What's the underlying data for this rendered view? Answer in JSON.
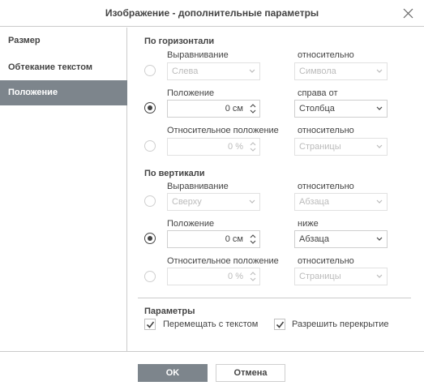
{
  "dialog": {
    "title": "Изображение - дополнительные параметры"
  },
  "sidebar": {
    "items": [
      {
        "label": "Размер"
      },
      {
        "label": "Обтекание текстом"
      },
      {
        "label": "Положение"
      }
    ]
  },
  "horizontal": {
    "title": "По горизонтали",
    "align_label": "Выравнивание",
    "align_value": "Слева",
    "align_relative_label": "относительно",
    "align_relative_value": "Символа",
    "position_label": "Положение",
    "position_value": "0 см",
    "position_relative_label": "справа от",
    "position_relative_value": "Столбца",
    "relpos_label": "Относительное положение",
    "relpos_value": "0 %",
    "relpos_relative_label": "относительно",
    "relpos_relative_value": "Страницы"
  },
  "vertical": {
    "title": "По вертикали",
    "align_label": "Выравнивание",
    "align_value": "Сверху",
    "align_relative_label": "относительно",
    "align_relative_value": "Абзаца",
    "position_label": "Положение",
    "position_value": "0 см",
    "position_relative_label": "ниже",
    "position_relative_value": "Абзаца",
    "relpos_label": "Относительное положение",
    "relpos_value": "0 %",
    "relpos_relative_label": "относительно",
    "relpos_relative_value": "Страницы"
  },
  "options": {
    "title": "Параметры",
    "move_with_text": "Перемещать с текстом",
    "allow_overlap": "Разрешить перекрытие"
  },
  "footer": {
    "ok_label": "OK",
    "cancel_label": "Отмена"
  }
}
